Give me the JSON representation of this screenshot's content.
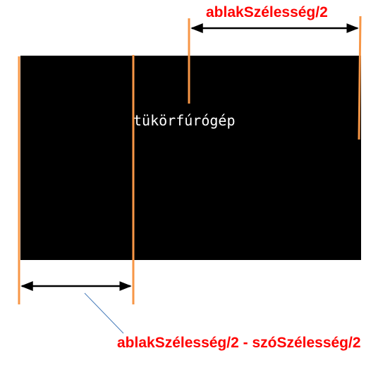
{
  "labels": {
    "top_label": "ablakSzélesség/2",
    "bottom_label": "ablakSzélesség/2  - szóSzélesség/2",
    "console_word": "tükörfúrógép"
  },
  "colors": {
    "window_background": "#000000",
    "window_text": "#ffffff",
    "marker_line": "#f79646",
    "label_text": "#ff0000",
    "arrow": "#000000",
    "pointer_line": "#4a7ebb"
  }
}
